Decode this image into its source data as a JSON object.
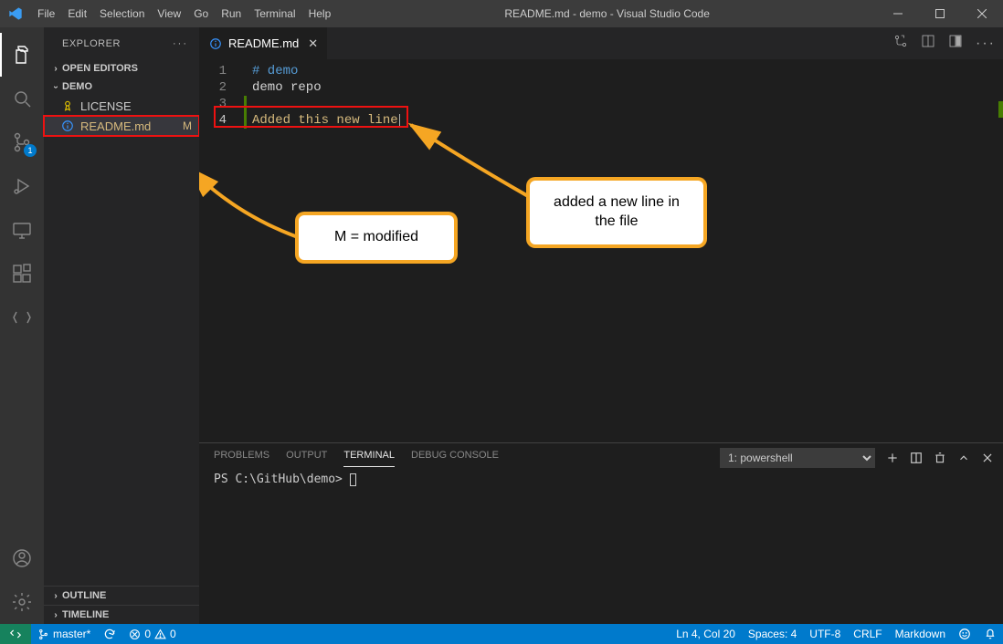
{
  "window": {
    "title": "README.md - demo - Visual Studio Code"
  },
  "menu": [
    "File",
    "Edit",
    "Selection",
    "View",
    "Go",
    "Run",
    "Terminal",
    "Help"
  ],
  "activity": {
    "scm_badge": "1"
  },
  "explorer": {
    "title": "EXPLORER",
    "open_editors": "OPEN EDITORS",
    "folder": "DEMO",
    "files": {
      "license": {
        "name": "LICENSE"
      },
      "readme": {
        "name": "README.md",
        "status": "M"
      }
    },
    "outline": "OUTLINE",
    "timeline": "TIMELINE"
  },
  "tab": {
    "name": "README.md"
  },
  "editor": {
    "lines": {
      "l1": "# demo",
      "l2": "demo repo",
      "l3": "",
      "l4": "Added this new line"
    }
  },
  "panel": {
    "tabs": {
      "problems": "PROBLEMS",
      "output": "OUTPUT",
      "terminal": "TERMINAL",
      "debug": "DEBUG CONSOLE"
    },
    "shell_option": "1: powershell",
    "prompt": "PS C:\\GitHub\\demo> "
  },
  "status": {
    "branch": "master*",
    "sync": "",
    "errors": "0",
    "warnings": "0",
    "ln_col": "Ln 4, Col 20",
    "spaces": "Spaces: 4",
    "encoding": "UTF-8",
    "eol": "CRLF",
    "lang": "Markdown"
  },
  "callouts": {
    "modified": "M = modified",
    "newline": "added a new line in the file"
  }
}
